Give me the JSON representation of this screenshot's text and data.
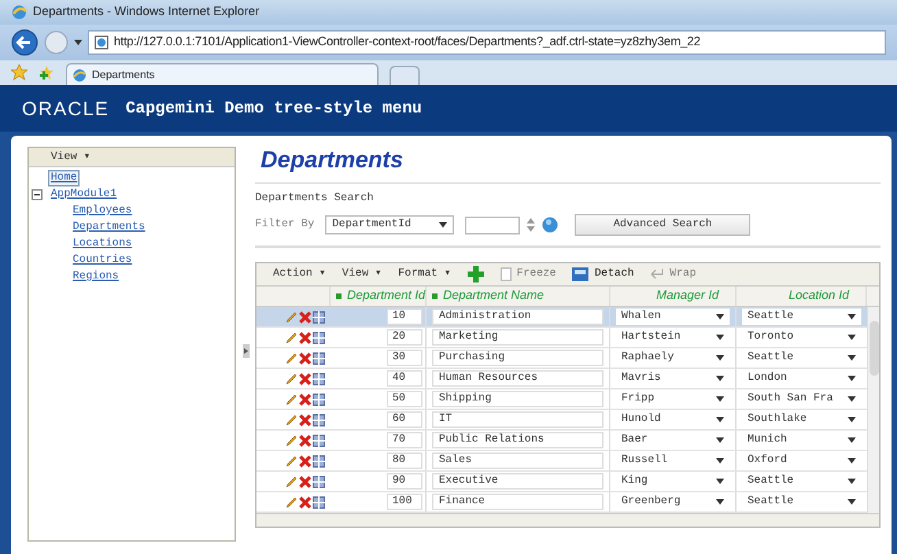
{
  "window": {
    "title": "Departments - Windows Internet Explorer"
  },
  "address_bar": {
    "url": "http://127.0.0.1:7101/Application1-ViewController-context-root/faces/Departments?_adf.ctrl-state=yz8zhy3em_22"
  },
  "browser_tabs": [
    {
      "label": "Departments",
      "selected": true
    }
  ],
  "banner": {
    "logo": "ORACLE",
    "title": "Capgemini Demo tree-style menu"
  },
  "sidebar": {
    "menu": "View ▾",
    "items": [
      {
        "label": "Home",
        "selected": true
      },
      {
        "label": "AppModule1",
        "selected": false,
        "expanded": true,
        "children": [
          {
            "label": "Employees",
            "selected": false
          },
          {
            "label": "Departments",
            "selected": false
          },
          {
            "label": "Locations",
            "selected": false
          },
          {
            "label": "Countries",
            "selected": false
          },
          {
            "label": "Regions",
            "selected": false
          }
        ]
      }
    ]
  },
  "page_title": "Departments",
  "search": {
    "heading": "Departments Search",
    "filter_label": "Filter By",
    "filter_field": "DepartmentId",
    "button": "Advanced Search"
  },
  "toolbar": {
    "menus": [
      "Action ▾",
      "View ▾",
      "Format ▾"
    ],
    "buttons": [
      {
        "label": "Freeze",
        "disabled": true
      },
      {
        "label": "Detach",
        "disabled": false
      },
      {
        "label": "Wrap",
        "disabled": true
      }
    ]
  },
  "table": {
    "columns": [
      "Department Id",
      "Department Name",
      "Manager Id",
      "Location Id"
    ],
    "rows": [
      {
        "selected": true,
        "id": "10",
        "name": "Administration",
        "manager": "Whalen",
        "location": "Seattle"
      },
      {
        "selected": false,
        "id": "20",
        "name": "Marketing",
        "manager": "Hartstein",
        "location": "Toronto"
      },
      {
        "selected": false,
        "id": "30",
        "name": "Purchasing",
        "manager": "Raphaely",
        "location": "Seattle"
      },
      {
        "selected": false,
        "id": "40",
        "name": "Human Resources",
        "manager": "Mavris",
        "location": "London"
      },
      {
        "selected": false,
        "id": "50",
        "name": "Shipping",
        "manager": "Fripp",
        "location": "South San Fra"
      },
      {
        "selected": false,
        "id": "60",
        "name": "IT",
        "manager": "Hunold",
        "location": "Southlake"
      },
      {
        "selected": false,
        "id": "70",
        "name": "Public Relations",
        "manager": "Baer",
        "location": "Munich"
      },
      {
        "selected": false,
        "id": "80",
        "name": "Sales",
        "manager": "Russell",
        "location": "Oxford"
      },
      {
        "selected": false,
        "id": "90",
        "name": "Executive",
        "manager": "King",
        "location": "Seattle"
      },
      {
        "selected": false,
        "id": "100",
        "name": "Finance",
        "manager": "Greenberg",
        "location": "Seattle"
      }
    ]
  }
}
